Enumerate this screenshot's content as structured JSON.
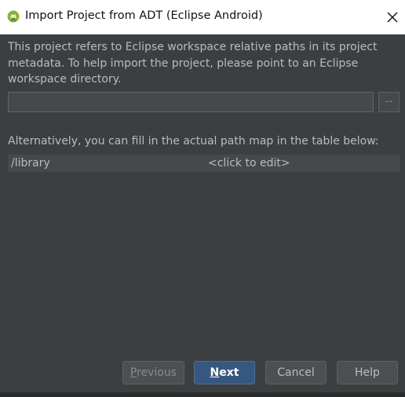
{
  "window": {
    "title": "Import Project from ADT (Eclipse Android)",
    "icon": "android-studio-icon",
    "close_icon": "close-icon"
  },
  "description": "This project refers to Eclipse workspace relative paths in its project metadata. To help import the project, please point to an Eclipse workspace directory.",
  "workspace_path": {
    "value": "",
    "placeholder": ""
  },
  "browse_button": {
    "label": "...",
    "icon": "ellipsis-icon"
  },
  "alternative_text": "Alternatively, you can fill in the actual path map in the table below:",
  "path_map": {
    "rows": [
      {
        "path": "/library",
        "value": "<click to edit>"
      }
    ]
  },
  "buttons": {
    "previous": {
      "mnemonic": "P",
      "rest": "revious",
      "enabled": false
    },
    "next": {
      "mnemonic": "N",
      "rest": "ext"
    },
    "cancel": "Cancel",
    "help": "Help"
  },
  "colors": {
    "background": "#3c3f41",
    "titlebar": "#ffffff",
    "text": "#bbbbbb",
    "primary_button": "#365880",
    "android_green": "#8bb13e"
  }
}
